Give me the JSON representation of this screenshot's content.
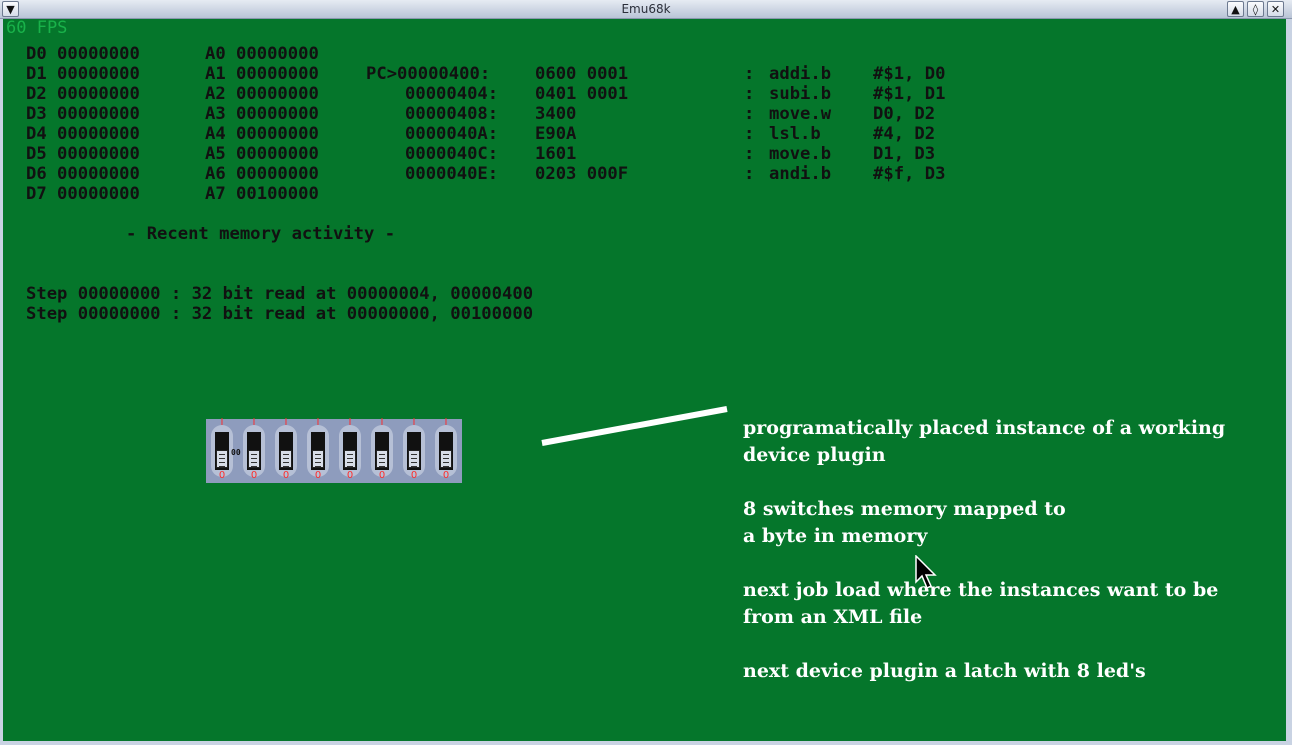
{
  "window": {
    "title": "Emu68k"
  },
  "overlay": {
    "fps": "60 FPS"
  },
  "registers": [
    {
      "d": "D0 00000000",
      "a": "A0 00000000"
    },
    {
      "d": "D1 00000000",
      "a": "A1 00000000"
    },
    {
      "d": "D2 00000000",
      "a": "A2 00000000"
    },
    {
      "d": "D3 00000000",
      "a": "A3 00000000"
    },
    {
      "d": "D4 00000000",
      "a": "A4 00000000"
    },
    {
      "d": "D5 00000000",
      "a": "A5 00000000"
    },
    {
      "d": "D6 00000000",
      "a": "A6 00000000"
    },
    {
      "d": "D7 00000000",
      "a": "A7 00100000"
    }
  ],
  "disassembly": [
    {
      "addr": "PC>00000400:",
      "bytes": "0600 0001",
      "sep": ":",
      "mnemonic": "addi.b",
      "operands": "#$1, D0"
    },
    {
      "addr": "00000404:",
      "bytes": "0401 0001",
      "sep": ":",
      "mnemonic": "subi.b",
      "operands": "#$1, D1"
    },
    {
      "addr": "00000408:",
      "bytes": "3400",
      "sep": ":",
      "mnemonic": "move.w",
      "operands": "D0, D2"
    },
    {
      "addr": "0000040A:",
      "bytes": "E90A",
      "sep": ":",
      "mnemonic": "lsl.b",
      "operands": "#4, D2"
    },
    {
      "addr": "0000040C:",
      "bytes": "1601",
      "sep": ":",
      "mnemonic": "move.b",
      "operands": "D1, D3"
    },
    {
      "addr": "0000040E:",
      "bytes": "0203 000F",
      "sep": ":",
      "mnemonic": "andi.b",
      "operands": "#$f, D3"
    }
  ],
  "memory": {
    "heading": "- Recent memory activity -",
    "lines": [
      "Step 00000000 : 32 bit read at 00000004, 00000400",
      "Step 00000000 : 32 bit read at 00000000, 00100000"
    ]
  },
  "device": {
    "value": "00",
    "switches": [
      {
        "top": "I",
        "bottom": "0"
      },
      {
        "top": "I",
        "bottom": "0"
      },
      {
        "top": "I",
        "bottom": "0"
      },
      {
        "top": "I",
        "bottom": "0"
      },
      {
        "top": "I",
        "bottom": "0"
      },
      {
        "top": "I",
        "bottom": "0"
      },
      {
        "top": "I",
        "bottom": "0"
      },
      {
        "top": "I",
        "bottom": "0"
      }
    ]
  },
  "notes": [
    "programatically placed instance of a working",
    "device plugin",
    "8 switches memory mapped to",
    "a byte in memory",
    "next job load where the instances want to be",
    "from an XML file",
    "next device plugin a latch with 8 led's"
  ]
}
